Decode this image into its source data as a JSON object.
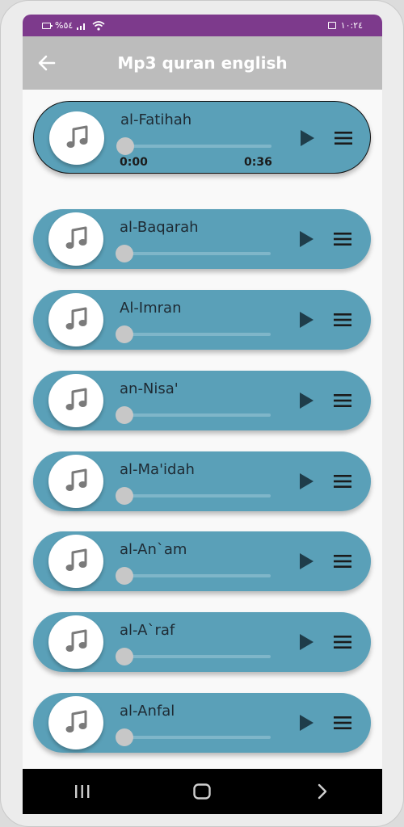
{
  "status_bar": {
    "left_text": "%٥٤",
    "right_time": "١٠:٢٤"
  },
  "app_bar": {
    "title": "Mp3 quran english"
  },
  "colors": {
    "status_bar": "#7d3a8c",
    "app_bar": "#bcbcbc",
    "card": "#5aa0b8",
    "nav_bar": "#000000"
  },
  "player": {
    "current_time": "0:00",
    "duration": "0:36",
    "progress": 0
  },
  "tracks": [
    {
      "title": "al-Fatihah",
      "active": true
    },
    {
      "title": "al-Baqarah",
      "active": false
    },
    {
      "title": "Al-Imran",
      "active": false
    },
    {
      "title": "an-Nisa'",
      "active": false
    },
    {
      "title": "al-Ma'idah",
      "active": false
    },
    {
      "title": "al-An`am",
      "active": false
    },
    {
      "title": "al-A`raf",
      "active": false
    },
    {
      "title": "al-Anfal",
      "active": false
    }
  ],
  "icons": {
    "back": "arrow-back-icon",
    "track": "music-note-icon",
    "play": "play-icon",
    "menu": "menu-icon",
    "recents": "recents-icon",
    "home": "home-icon",
    "nav_back": "chevron-right-icon"
  }
}
